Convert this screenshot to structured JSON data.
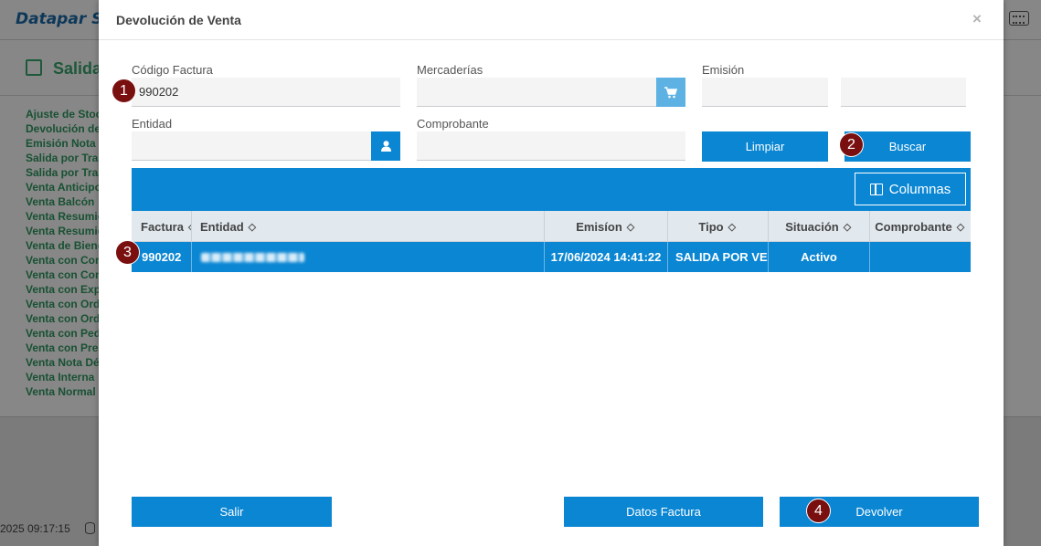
{
  "background": {
    "logo": "Datapar Sa",
    "page_title": "Salida",
    "menu_items": [
      "Ajuste de Stoc",
      "Devolución de",
      "Emisión Nota d",
      "Salida por Tran",
      "Salida por Tran",
      "Venta Anticipo",
      "Venta Balcón",
      "Venta Resumio",
      "Venta Resumio",
      "Venta de Biene",
      "Venta con Con",
      "Venta con Con",
      "Venta con Exp",
      "Venta con Ord",
      "Venta con Ord",
      "Venta con Pedi",
      "Venta con Pres",
      "Venta Nota Dé",
      "Venta Interna",
      "Venta Normal"
    ],
    "footer_time": "2025 09:17:15"
  },
  "modal": {
    "title": "Devolución de Venta",
    "close": "×",
    "fields": {
      "codigo_factura": {
        "label": "Código Factura",
        "value": "990202"
      },
      "mercaderias": {
        "label": "Mercaderías",
        "value": ""
      },
      "emision": {
        "label": "Emisión",
        "from": "",
        "to": ""
      },
      "entidad": {
        "label": "Entidad",
        "value": ""
      },
      "comprobante": {
        "label": "Comprobante",
        "value": ""
      }
    },
    "buttons": {
      "limpiar": "Limpiar",
      "buscar": "Buscar",
      "columnas": "Columnas",
      "salir": "Salir",
      "datos_factura": "Datos Factura",
      "devolver": "Devolver"
    },
    "table": {
      "headers": [
        "Factura",
        "Entidad",
        "Emisíon",
        "Tipo",
        "Situación",
        "Comprobante"
      ],
      "rows": [
        {
          "factura": "990202",
          "entidad": "",
          "emision": "17/06/2024 14:41:22",
          "tipo": "SALIDA POR VEN",
          "situacion": "Activo",
          "comprobante": ""
        }
      ]
    },
    "badges": [
      "1",
      "2",
      "3",
      "4"
    ]
  },
  "colors": {
    "primary": "#0a86d3",
    "badge": "#7a0f0f",
    "menu_green": "#2e9a60",
    "header_bg": "#e1e8ee"
  },
  "icons": [
    "cart-icon",
    "user-icon",
    "columns-icon",
    "sort-icon",
    "keyboard-icon",
    "database-icon",
    "external-link-icon"
  ]
}
